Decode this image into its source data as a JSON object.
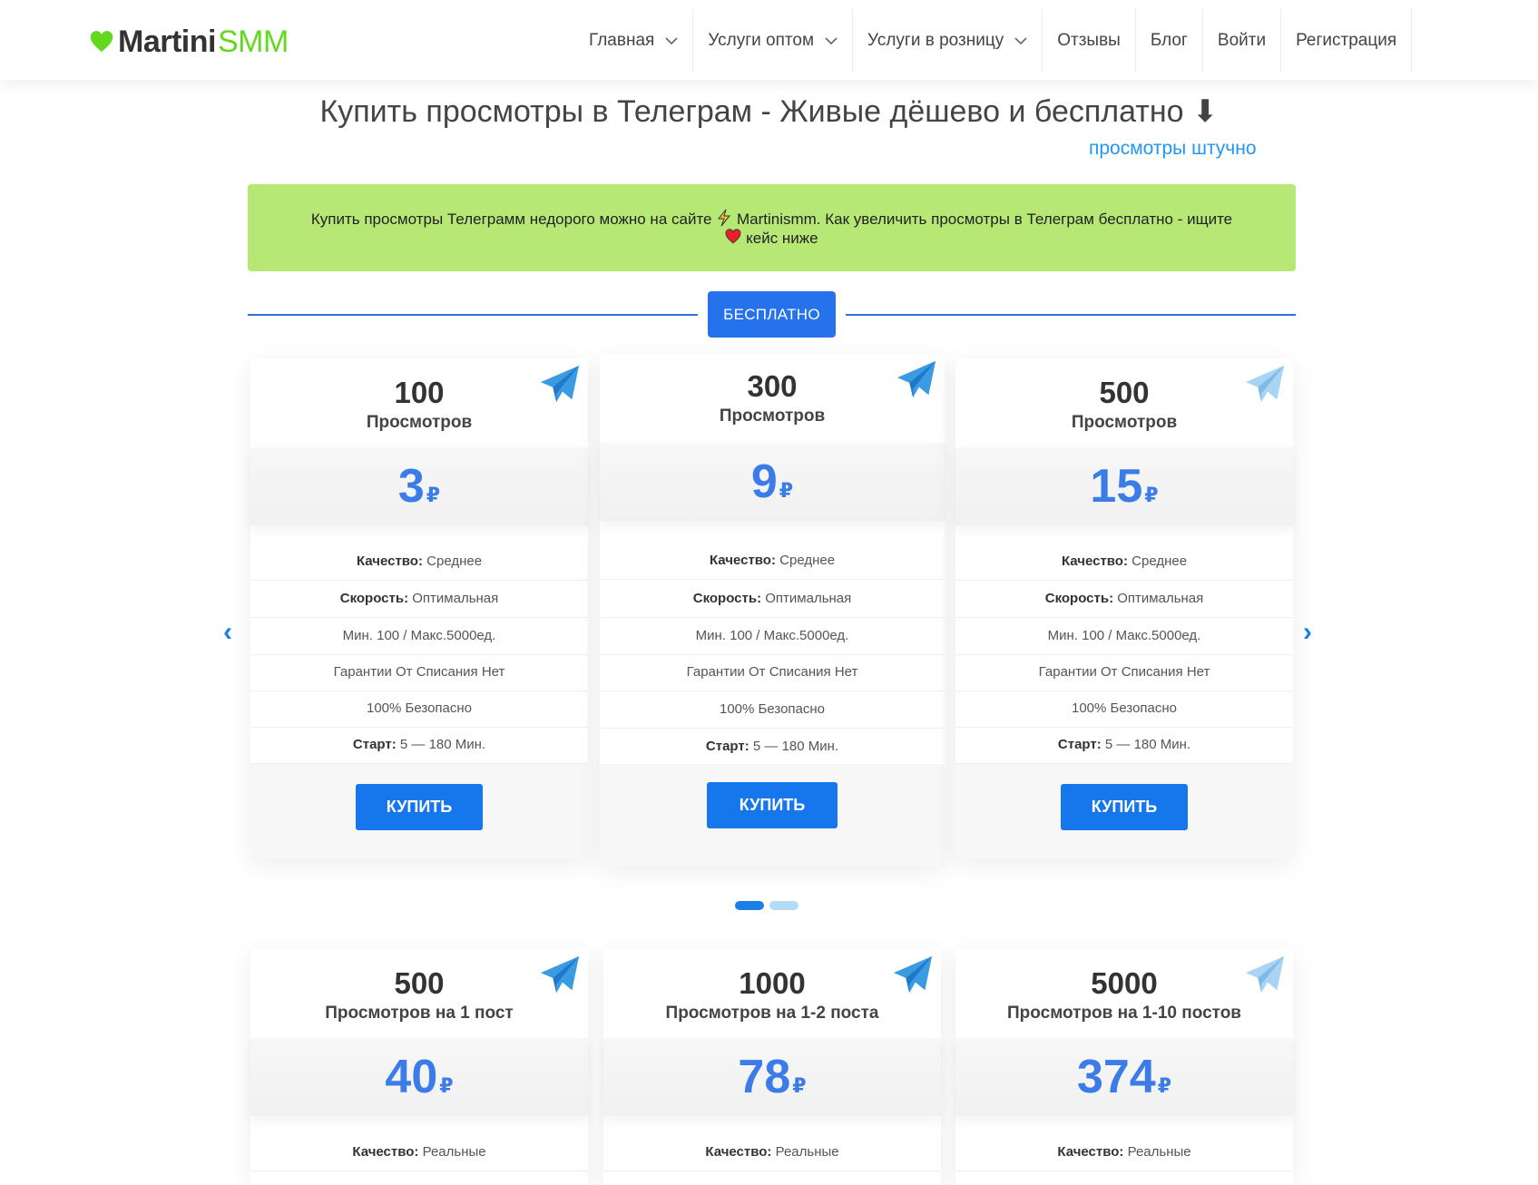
{
  "header": {
    "brand_bold": "Martini",
    "brand_light": "SMM",
    "nav": [
      {
        "label": "Главная",
        "has_dropdown": true
      },
      {
        "label": "Услуги оптом",
        "has_dropdown": true
      },
      {
        "label": "Услуги в розницу",
        "has_dropdown": true
      },
      {
        "label": "Отзывы",
        "has_dropdown": false
      },
      {
        "label": "Блог",
        "has_dropdown": false
      },
      {
        "label": "Войти",
        "has_dropdown": false
      },
      {
        "label": "Регистрация",
        "has_dropdown": false
      }
    ]
  },
  "page": {
    "title": "Купить просмотры в Телеграм - Живые дёшево и бесплатно ⬇",
    "sub_link": "просмотры штучно",
    "banner_part1": "Купить просмотры Телеграмм недорого можно на сайте",
    "banner_part2": "Martinismm. Как увеличить просмотры в Телеграм бесплатно - ищите",
    "banner_part3": "кейс ниже",
    "free_button": "БЕСПЛАТНО",
    "carousel_prev": "‹",
    "carousel_next": "›"
  },
  "colors": {
    "accent": "#2672ec",
    "price": "#3c7ce8",
    "banner": "#b7e876",
    "brand_green": "#62d91f"
  },
  "cards_row1": [
    {
      "qty": "100",
      "unit": "Просмотров",
      "price": "3",
      "currency": "₽",
      "quality_label": "Качество:",
      "quality_value": "Среднее",
      "speed_label": "Скорость:",
      "speed_value": "Оптимальная",
      "limits": "Мин. 100 / Макс.5000ед.",
      "guarantee": "Гарантии От Списания Нет",
      "safe": "100% Безопасно",
      "start_label": "Старт:",
      "start_value": "5 — 180 Мин.",
      "buy": "КУПИТЬ"
    },
    {
      "qty": "300",
      "unit": "Просмотров",
      "price": "9",
      "currency": "₽",
      "quality_label": "Качество:",
      "quality_value": "Среднее",
      "speed_label": "Скорость:",
      "speed_value": "Оптимальная",
      "limits": "Мин. 100 / Макс.5000ед.",
      "guarantee": "Гарантии От Списания Нет",
      "safe": "100% Безопасно",
      "start_label": "Старт:",
      "start_value": "5 — 180 Мин.",
      "buy": "КУПИТЬ"
    },
    {
      "qty": "500",
      "unit": "Просмотров",
      "price": "15",
      "currency": "₽",
      "quality_label": "Качество:",
      "quality_value": "Среднее",
      "speed_label": "Скорость:",
      "speed_value": "Оптимальная",
      "limits": "Мин. 100 / Макс.5000ед.",
      "guarantee": "Гарантии От Списания Нет",
      "safe": "100% Безопасно",
      "start_label": "Старт:",
      "start_value": "5 — 180 Мин.",
      "buy": "КУПИТЬ"
    }
  ],
  "cards_row2": [
    {
      "qty": "500",
      "unit": "Просмотров на 1 пост",
      "price": "40",
      "currency": "₽",
      "quality_label": "Качество:",
      "quality_value": "Реальные"
    },
    {
      "qty": "1000",
      "unit": "Просмотров на 1-2 поста",
      "price": "78",
      "currency": "₽",
      "quality_label": "Качество:",
      "quality_value": "Реальные"
    },
    {
      "qty": "5000",
      "unit": "Просмотров на 1-10 постов",
      "price": "374",
      "currency": "₽",
      "quality_label": "Качество:",
      "quality_value": "Реальные"
    }
  ],
  "carousel": {
    "pages": 2,
    "active_page": 1
  }
}
